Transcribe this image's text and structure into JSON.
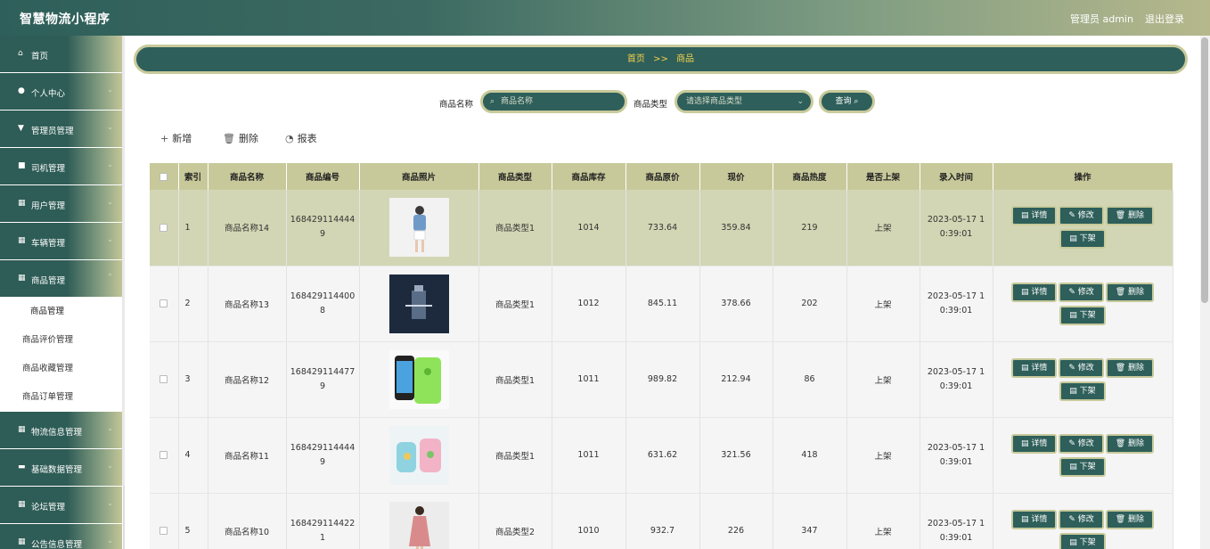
{
  "header": {
    "title": "智慧物流小程序",
    "user": "管理员 admin",
    "logout": "退出登录"
  },
  "sidebar": {
    "items": [
      {
        "icon": "⌂",
        "label": "首页",
        "chev": ""
      },
      {
        "icon": "●",
        "label": "个人中心",
        "chev": "⌄"
      },
      {
        "icon": "▼",
        "label": "管理员管理",
        "chev": "⌄"
      },
      {
        "icon": "■",
        "label": "司机管理",
        "chev": "⌄"
      },
      {
        "icon": "▦",
        "label": "用户管理",
        "chev": "⌄"
      },
      {
        "icon": "▦",
        "label": "车辆管理",
        "chev": "⌄"
      },
      {
        "icon": "▦",
        "label": "商品管理",
        "chev": "⌃"
      }
    ],
    "sub": [
      "商品管理",
      "商品评价管理",
      "商品收藏管理",
      "商品订单管理"
    ],
    "items_after": [
      {
        "icon": "▦",
        "label": "物流信息管理",
        "chev": "⌄"
      },
      {
        "icon": "▬",
        "label": "基础数据管理",
        "chev": "⌄"
      },
      {
        "icon": "▦",
        "label": "论坛管理",
        "chev": "⌄"
      },
      {
        "icon": "▦",
        "label": "公告信息管理",
        "chev": "⌄"
      }
    ]
  },
  "breadcrumb": {
    "home": "首页",
    "sep": ">>",
    "current": "商品"
  },
  "search": {
    "name_label": "商品名称",
    "name_placeholder": "商品名称",
    "type_label": "商品类型",
    "type_placeholder": "请选择商品类型",
    "button": "查询"
  },
  "toolbar": {
    "add": "新增",
    "delete": "删除",
    "report": "报表"
  },
  "table": {
    "headers": [
      "索引",
      "商品名称",
      "商品编号",
      "商品照片",
      "商品类型",
      "商品库存",
      "商品原价",
      "现价",
      "商品热度",
      "是否上架",
      "录入时间",
      "操作"
    ],
    "ops": {
      "detail": "详情",
      "edit": "修改",
      "del": "删除",
      "off": "下架"
    },
    "rows": [
      {
        "idx": "1",
        "name": "商品名称14",
        "code": "1684291144449",
        "type": "商品类型1",
        "stock": "1014",
        "orig": "733.64",
        "price": "359.84",
        "heat": "219",
        "onsale": "上架",
        "time": "2023-05-17 10:39:01",
        "photo": "shirt-photo"
      },
      {
        "idx": "2",
        "name": "商品名称13",
        "code": "1684291144008",
        "type": "商品类型1",
        "stock": "1012",
        "orig": "845.11",
        "price": "378.66",
        "heat": "202",
        "onsale": "上架",
        "time": "2023-05-17 10:39:01",
        "photo": "cosmetics-photo"
      },
      {
        "idx": "3",
        "name": "商品名称12",
        "code": "1684291144779",
        "type": "商品类型1",
        "stock": "1011",
        "orig": "989.82",
        "price": "212.94",
        "heat": "86",
        "onsale": "上架",
        "time": "2023-05-17 10:39:01",
        "photo": "phone-photo"
      },
      {
        "idx": "4",
        "name": "商品名称11",
        "code": "1684291144449",
        "type": "商品类型1",
        "stock": "1011",
        "orig": "631.62",
        "price": "321.56",
        "heat": "418",
        "onsale": "上架",
        "time": "2023-05-17 10:39:01",
        "photo": "cups-photo"
      },
      {
        "idx": "5",
        "name": "商品名称10",
        "code": "1684291144221",
        "type": "商品类型2",
        "stock": "1010",
        "orig": "932.7",
        "price": "226",
        "heat": "347",
        "onsale": "上架",
        "time": "2023-05-17 10:39:01",
        "photo": "dress-photo"
      }
    ]
  }
}
